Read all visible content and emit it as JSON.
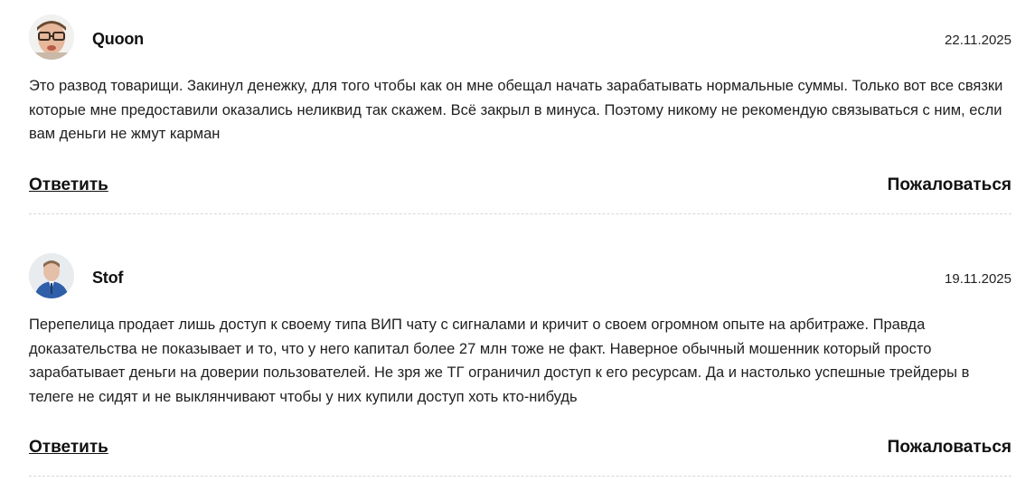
{
  "comments": [
    {
      "author": "Quoon",
      "date": "22.11.2025",
      "text": "Это развод товарищи. Закинул денежку, для того чтобы как он мне обещал начать зарабатывать нормальные суммы. Только вот все связки которые мне предоставили оказались неликвид так скажем. Всё закрыл в минуса. Поэтому никому не рекомендую связываться с ним, если вам деньги не жмут карман",
      "reply_label": "Ответить",
      "report_label": "Пожаловаться"
    },
    {
      "author": "Stof",
      "date": "19.11.2025",
      "text": "Перепелица продает лишь доступ к своему типа ВИП чату с сигналами и кричит о своем огромном опыте на арбитраже. Правда доказательства не показывает и то, что у него капитал более 27 млн тоже не факт. Наверное обычный мошенник который просто зарабатывает деньги на доверии пользователей. Не зря же ТГ ограничил доступ к его ресурсам. Да и настолько успешные трейдеры в телеге не сидят и не выклянчивают чтобы у них купили доступ хоть кто-нибудь",
      "reply_label": "Ответить",
      "report_label": "Пожаловаться"
    }
  ]
}
